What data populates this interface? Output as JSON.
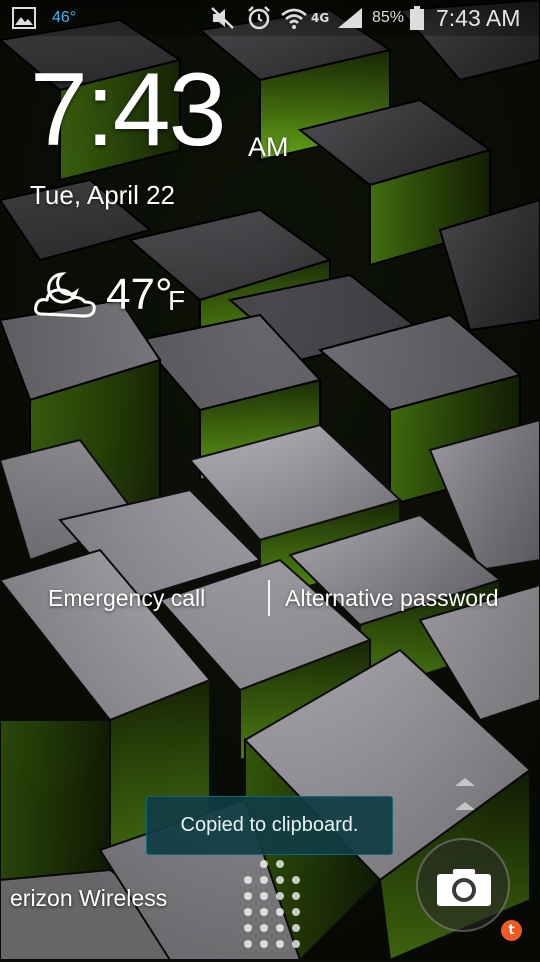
{
  "status_bar": {
    "gallery_icon": "gallery-icon",
    "weather_temp": "46°",
    "mute_icon": "mute-icon",
    "alarm_icon": "alarm-icon",
    "wifi_icon": "wifi-icon",
    "network_label": "4G",
    "signal_icon": "signal-icon",
    "battery_percent": "85%",
    "battery_icon": "battery-icon",
    "time": "7:43 AM"
  },
  "lock_screen": {
    "clock": "7:43",
    "ampm": "AM",
    "date": "Tue, April 22",
    "weather": {
      "icon": "moon-cloud-icon",
      "temp": "47°",
      "unit": "F"
    },
    "emergency_call": "Emergency call",
    "alternative_password": "Alternative password",
    "carrier": "erizon Wireless",
    "unlock_arrows_icon": "chevron-up-icon",
    "camera_icon": "camera-icon",
    "notification_badge": "t"
  },
  "toast": {
    "message": "Copied to clipboard."
  },
  "colors": {
    "accent_green": "#6fb51a",
    "toast_bg": "#113c44",
    "badge_orange": "#ee5a24"
  }
}
